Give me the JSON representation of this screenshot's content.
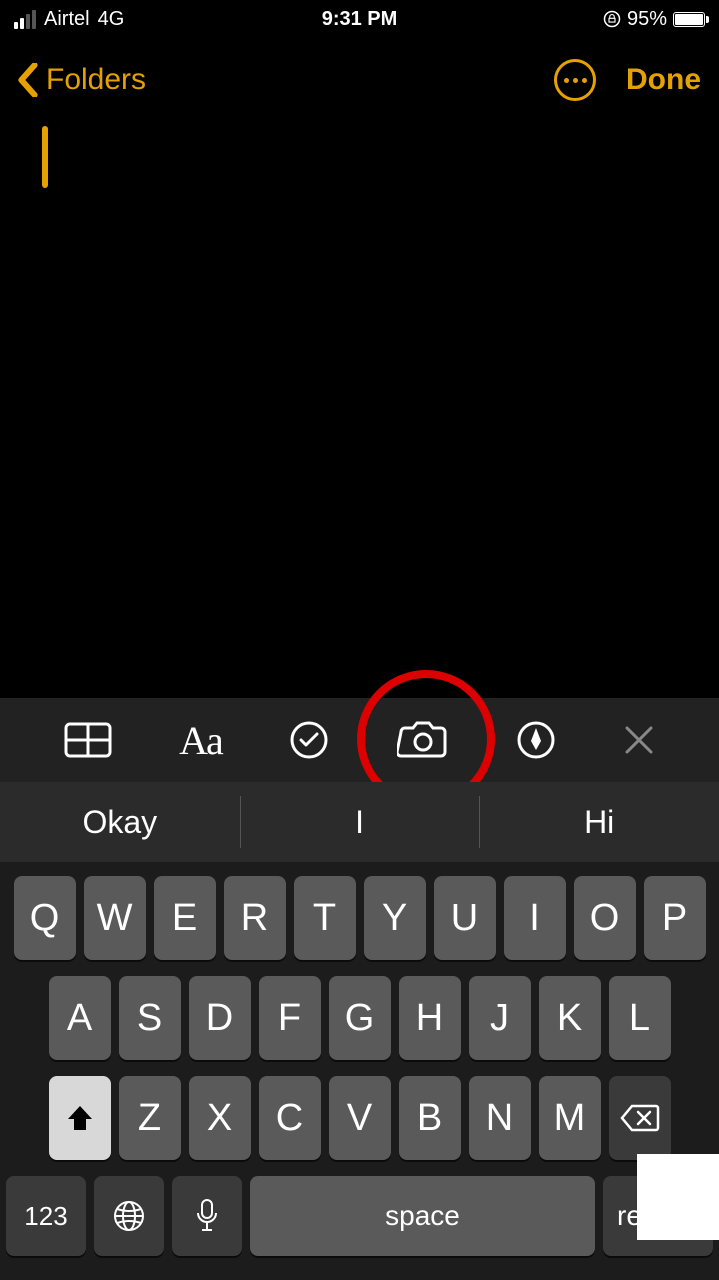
{
  "status": {
    "carrier": "Airtel",
    "network": "4G",
    "time": "9:31 PM",
    "battery_pct": "95%"
  },
  "nav": {
    "back_label": "Folders",
    "done_label": "Done"
  },
  "toolbar": {
    "table_icon": "table-icon",
    "format_icon": "Aa",
    "checklist_icon": "checklist-icon",
    "camera_icon": "camera-icon",
    "markup_icon": "markup-icon",
    "close_icon": "close-icon"
  },
  "suggestions": [
    "Okay",
    "I",
    "Hi"
  ],
  "keyboard": {
    "row1": [
      "Q",
      "W",
      "E",
      "R",
      "T",
      "Y",
      "U",
      "I",
      "O",
      "P"
    ],
    "row2": [
      "A",
      "S",
      "D",
      "F",
      "G",
      "H",
      "J",
      "K",
      "L"
    ],
    "row3": [
      "Z",
      "X",
      "C",
      "V",
      "B",
      "N",
      "M"
    ],
    "numbers_label": "123",
    "space_label": "space",
    "return_label": "return"
  }
}
